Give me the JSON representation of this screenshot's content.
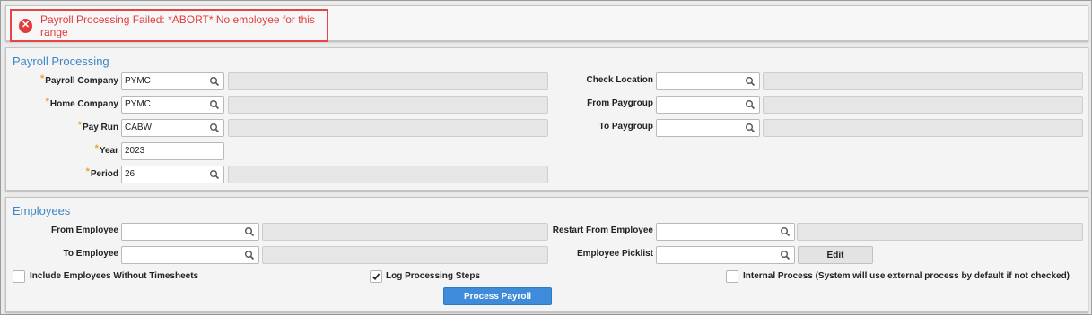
{
  "error": {
    "icon": "error-circle-icon",
    "message": "Payroll Processing Failed: *ABORT* No employee for this range",
    "color": "#e03c3c"
  },
  "payroll": {
    "title": "Payroll Processing",
    "payroll_company_label": "Payroll Company",
    "payroll_company_value": "PYMC",
    "home_company_label": "Home Company",
    "home_company_value": "PYMC",
    "pay_run_label": "Pay Run",
    "pay_run_value": "CABW",
    "year_label": "Year",
    "year_value": "2023",
    "period_label": "Period",
    "period_value": "26",
    "check_location_label": "Check Location",
    "check_location_value": "",
    "from_paygroup_label": "From Paygroup",
    "from_paygroup_value": "",
    "to_paygroup_label": "To Paygroup",
    "to_paygroup_value": ""
  },
  "employees": {
    "title": "Employees",
    "from_employee_label": "From Employee",
    "from_employee_value": "",
    "to_employee_label": "To Employee",
    "to_employee_value": "",
    "restart_from_label": "Restart From Employee",
    "restart_from_value": "",
    "picklist_label": "Employee Picklist",
    "picklist_value": "",
    "edit_label": "Edit",
    "include_without_timesheets_label": "Include Employees Without Timesheets",
    "include_without_timesheets_checked": false,
    "log_steps_label": "Log Processing Steps",
    "log_steps_checked": true,
    "internal_process_label": "Internal Process (System will use external process by default if not checked)",
    "internal_process_checked": false,
    "process_button_label": "Process Payroll"
  },
  "colors": {
    "accent": "#3a86c8",
    "primary_button": "#3d8bd9",
    "required_star": "#f0a030",
    "error": "#e03c3c"
  }
}
